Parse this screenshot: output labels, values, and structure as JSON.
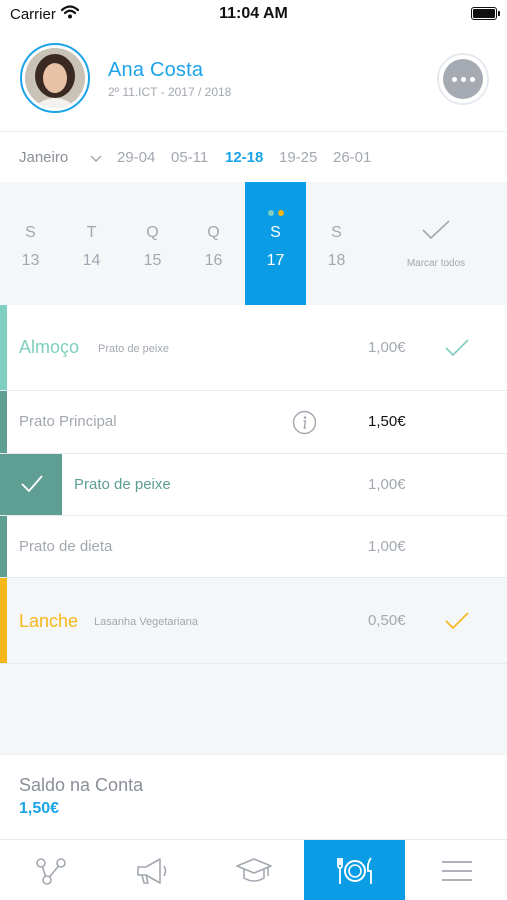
{
  "status_bar": {
    "carrier": "Carrier",
    "time": "11:04 AM"
  },
  "profile": {
    "name": "Ana Costa",
    "subtitle": "2º 11.ICT - 2017 / 2018"
  },
  "week_selector": {
    "month": "Janeiro",
    "weeks": [
      "29-04",
      "05-11",
      "12-18",
      "19-25",
      "26-01"
    ],
    "active_week": "12-18"
  },
  "days": [
    {
      "letter": "S",
      "num": "13"
    },
    {
      "letter": "T",
      "num": "14"
    },
    {
      "letter": "Q",
      "num": "15"
    },
    {
      "letter": "Q",
      "num": "16"
    },
    {
      "letter": "S",
      "num": "17"
    },
    {
      "letter": "S",
      "num": "18"
    }
  ],
  "mark_all_label": "Marcar todos",
  "meals": {
    "lunch": {
      "title": "Almoço",
      "selected": "Prato de peixe",
      "price": "1,00€",
      "color": "#7ecfbf"
    },
    "main_dish": {
      "name": "Prato Principal",
      "price": "1,50€"
    },
    "fish": {
      "name": "Prato de peixe",
      "price": "1,00€",
      "color": "#5e9e93"
    },
    "diet": {
      "name": "Prato de dieta",
      "price": "1,00€"
    },
    "snack": {
      "title": "Lanche",
      "selected": "Lasanha Vegetariana",
      "price": "0,50€",
      "color": "#f5b71a"
    }
  },
  "balance": {
    "label": "Saldo na Conta",
    "value": "1,50€"
  },
  "tabs": [
    "share-icon",
    "megaphone-icon",
    "graduation-cap-icon",
    "cutlery-icon",
    "menu-icon"
  ],
  "colors": {
    "accent": "#1aa3e8",
    "active_bg": "#0a9de6",
    "lunch": "#7ecfbf",
    "fish": "#5e9e93",
    "snack": "#f5b71a"
  }
}
